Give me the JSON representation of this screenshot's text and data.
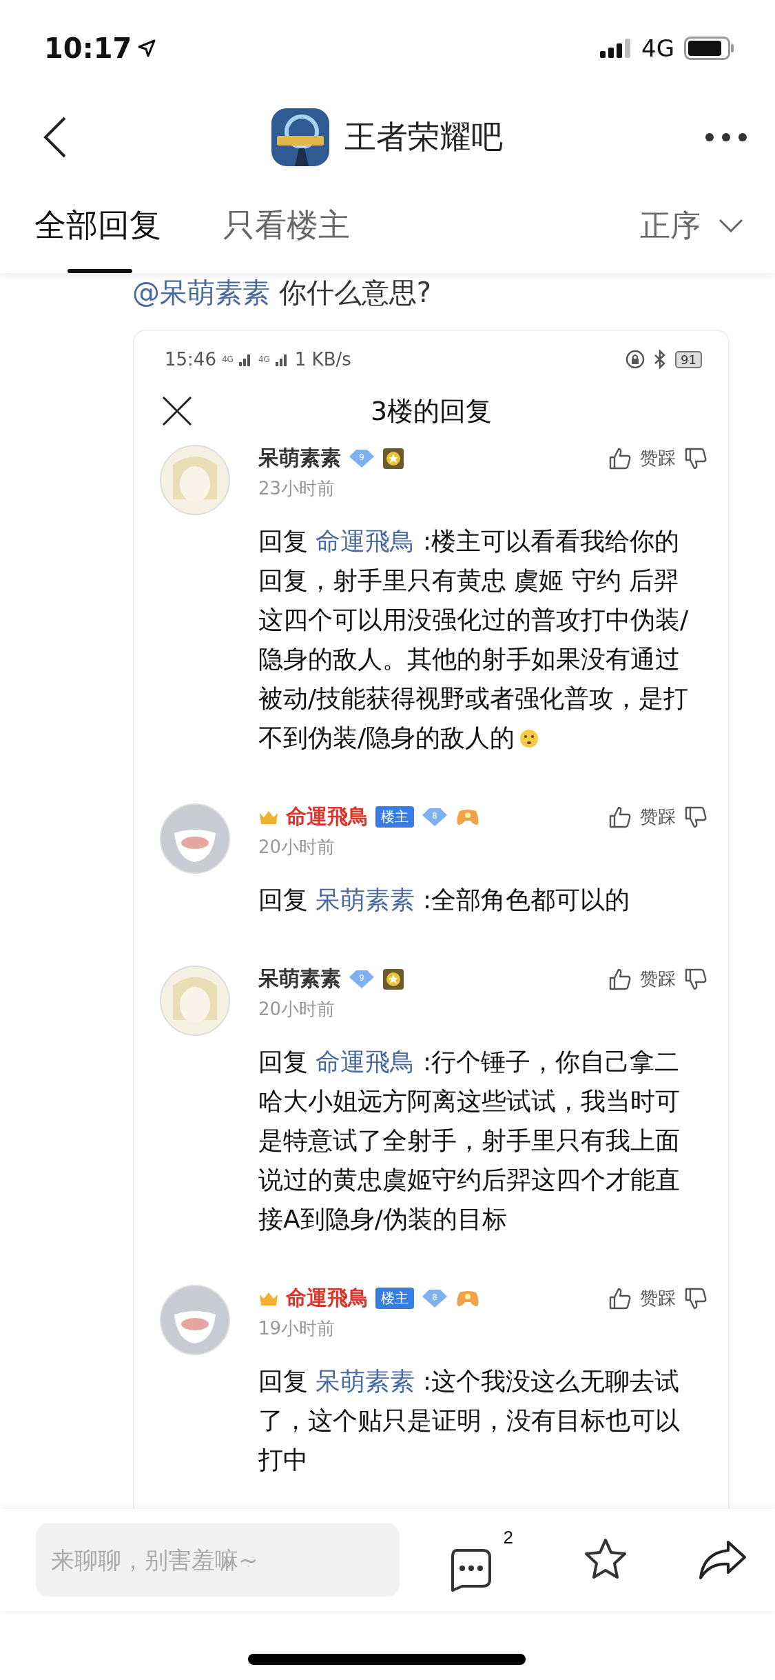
{
  "status_bar": {
    "time": "10:17",
    "network": "4G"
  },
  "nav": {
    "title": "王者荣耀吧"
  },
  "tabs": [
    {
      "label": "全部回复",
      "selected": true
    },
    {
      "label": "只看楼主",
      "selected": false
    }
  ],
  "sort": {
    "label": "正序"
  },
  "cut_line": {
    "mention": "@呆萌素素",
    "text": "你什么意思?"
  },
  "embedded": {
    "time": "15:46",
    "net_labels": [
      "4G",
      "4G"
    ],
    "speed": "1 KB/s",
    "battery": "91",
    "title": "3楼的回复",
    "comments": [
      {
        "user": "呆萌素素",
        "is_op": false,
        "level": "9",
        "time": "23小时前",
        "vote": "赞踩",
        "reply_label": "回复",
        "reply_to": "命運飛鳥",
        "text": " :楼主可以看看我给你的回复，射手里只有黄忠 虞姬 守约 后羿这四个可以用没强化过的普攻打中伪装/隐身的敌人。其他的射手如果没有通过被动/技能获得视野或者强化普攻，是打不到伪装/隐身的敌人的",
        "emoji": true
      },
      {
        "user": "命運飛鳥",
        "is_op": true,
        "tag": "楼主",
        "level": "8",
        "time": "20小时前",
        "vote": "赞踩",
        "reply_label": "回复",
        "reply_to": "呆萌素素",
        "text": " :全部角色都可以的"
      },
      {
        "user": "呆萌素素",
        "is_op": false,
        "level": "9",
        "time": "20小时前",
        "vote": "赞踩",
        "reply_label": "回复",
        "reply_to": "命運飛鳥",
        "text": " :行个锤子，你自己拿二哈大小姐远方阿离这些试试，我当时可是特意试了全射手，射手里只有我上面说过的黄忠虞姬守约后羿这四个才能直接A到隐身/伪装的目标"
      },
      {
        "user": "命運飛鳥",
        "is_op": true,
        "tag": "楼主",
        "level": "8",
        "time": "19小时前",
        "vote": "赞踩",
        "reply_label": "回复",
        "reply_to": "呆萌素素",
        "text": " :这个我没这么无聊去试了，这个贴只是证明，没有目标也可以打中"
      }
    ]
  },
  "bottom_bar": {
    "placeholder": "来聊聊，别害羞嘛~",
    "comment_count": "2"
  }
}
